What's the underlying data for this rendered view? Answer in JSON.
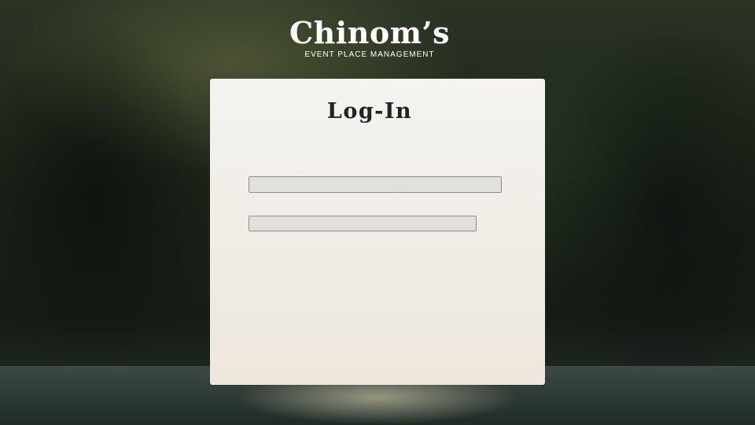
{
  "brand": {
    "name": "Chinom’s",
    "tagline": "EVENT PLACE MANAGEMENT"
  },
  "login": {
    "title": "Log-In",
    "username": {
      "value": "",
      "placeholder": ""
    },
    "password": {
      "value": "",
      "placeholder": ""
    }
  }
}
